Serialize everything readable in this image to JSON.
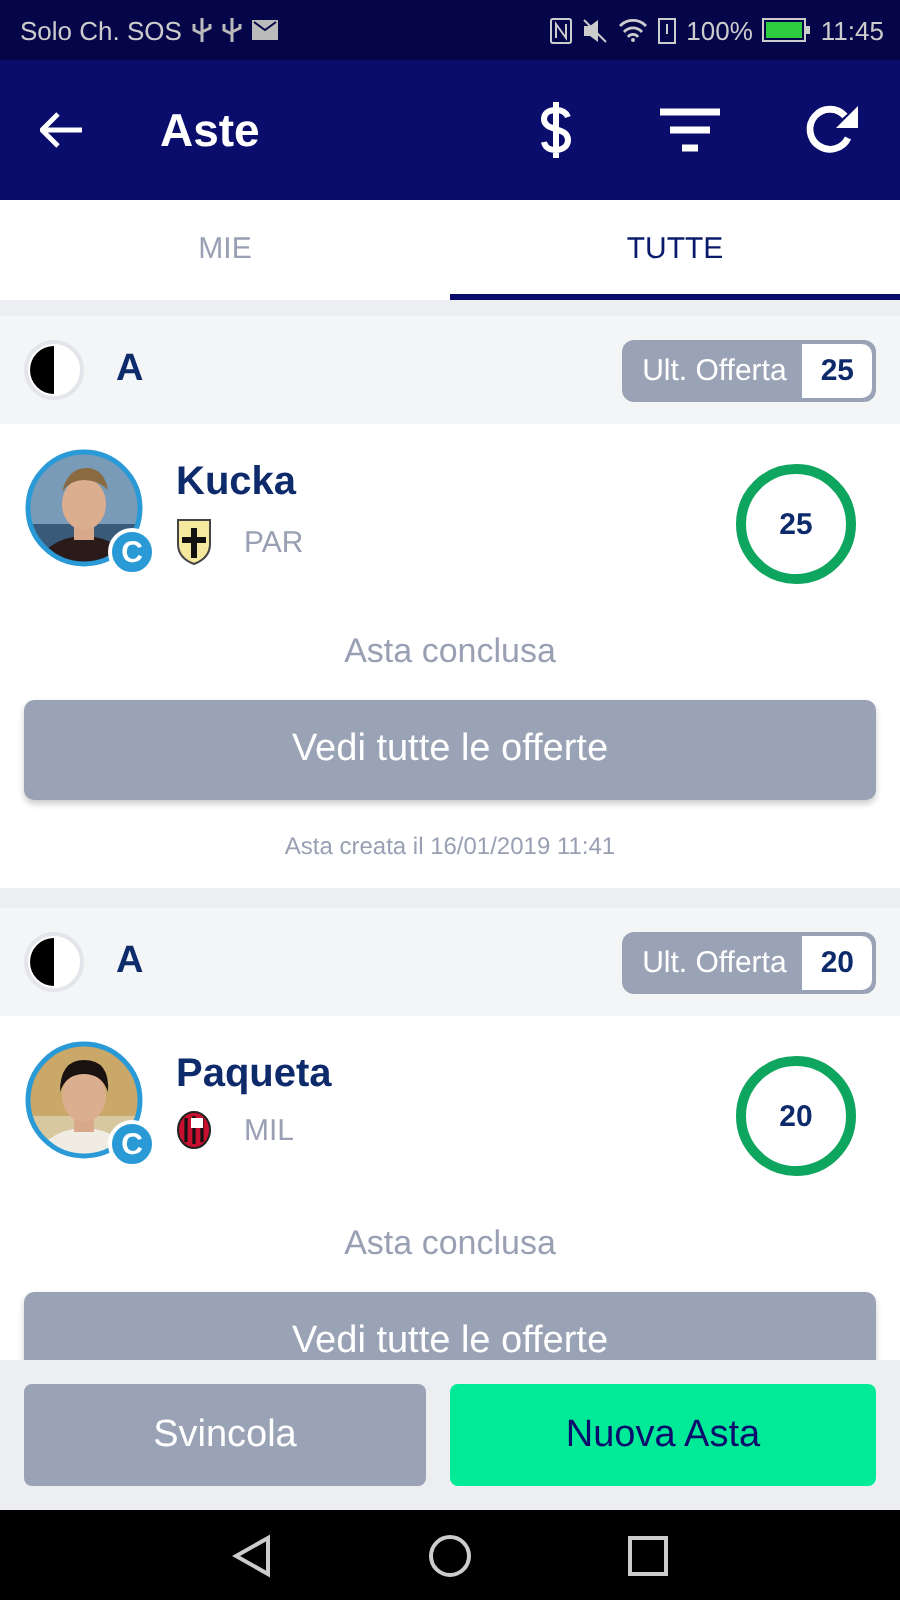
{
  "status_bar": {
    "carrier": "Solo Ch. SOS",
    "battery": "100%",
    "time": "11:45"
  },
  "app_bar": {
    "title": "Aste"
  },
  "tabs": [
    {
      "label": "MIE",
      "selected": false
    },
    {
      "label": "TUTTE",
      "selected": true
    }
  ],
  "auctions": [
    {
      "league": "A",
      "last_offer_label": "Ult. Offerta",
      "last_offer": "25",
      "player": {
        "name": "Kucka",
        "role": "C",
        "team": "PAR"
      },
      "bid": "25",
      "status": "Asta conclusa",
      "button": "Vedi tutte le offerte",
      "created": "Asta creata il 16/01/2019 11:41"
    },
    {
      "league": "A",
      "last_offer_label": "Ult. Offerta",
      "last_offer": "20",
      "player": {
        "name": "Paqueta",
        "role": "C",
        "team": "MIL"
      },
      "bid": "20",
      "status": "Asta conclusa",
      "button": "Vedi tutte le offerte"
    }
  ],
  "footer_buttons": [
    {
      "label": "Svincola",
      "kind": "secondary"
    },
    {
      "label": "Nuova Asta",
      "kind": "primary"
    }
  ]
}
